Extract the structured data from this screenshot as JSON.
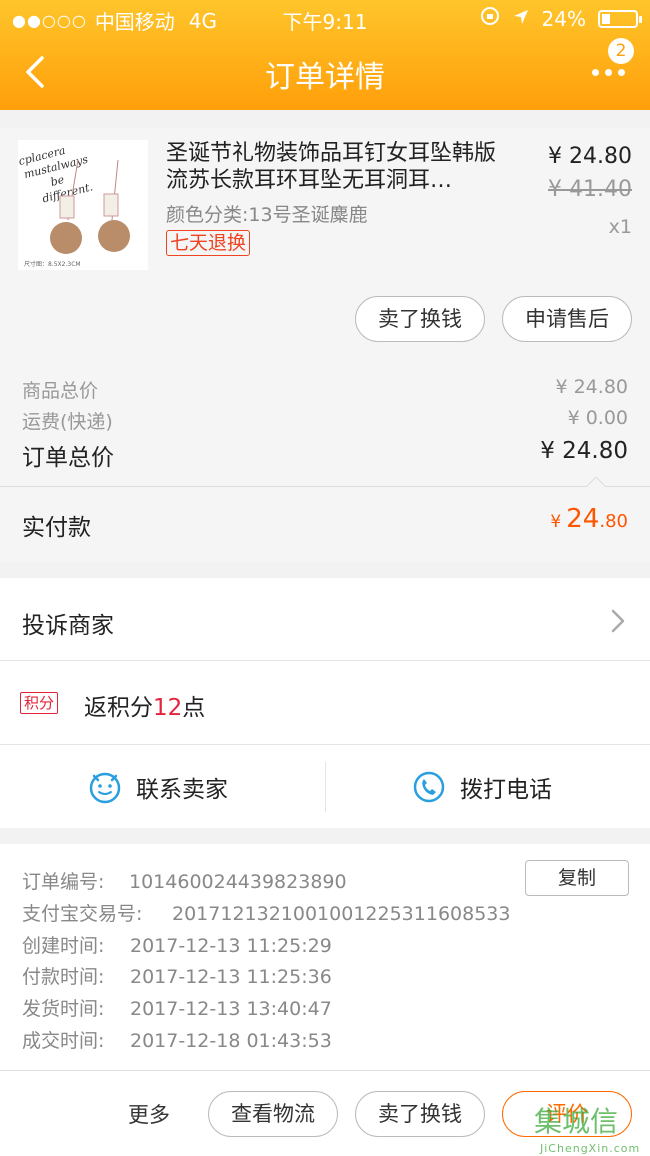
{
  "status_bar": {
    "signal": "●●○○○",
    "carrier": "中国移动",
    "network": "4G",
    "time": "下午9:11",
    "battery": "24%",
    "battery_level": 0.24
  },
  "nav": {
    "title": "订单详情",
    "badge": "2"
  },
  "product": {
    "title": "圣诞节礼物装饰品耳钉女耳坠韩版流苏长款耳环耳坠无耳洞耳…",
    "variant": "颜色分类:13号圣诞麋鹿",
    "tag": "七天退换",
    "price": "¥ 24.80",
    "original_price": "¥ 41.40",
    "quantity": "x1",
    "thumb_text_1": "cplacera",
    "thumb_text_2": "mustalways",
    "thumb_text_3": "be",
    "thumb_text_4": "different.",
    "thumb_caption": "尺寸图：8.5X2.3CM",
    "actions": {
      "sell": "卖了换钱",
      "after_sale": "申请售后"
    }
  },
  "totals": {
    "goods_label": "商品总价",
    "goods_value": "¥ 24.80",
    "shipping_label": "运费(快递)",
    "shipping_value": "¥ 0.00",
    "order_label": "订单总价",
    "order_value": "¥ 24.80",
    "paid_label": "实付款",
    "paid_currency": "¥",
    "paid_int": "24",
    "paid_dec": ".80"
  },
  "complain": {
    "label": "投诉商家"
  },
  "points": {
    "tag": "积分",
    "prefix": "返积分",
    "count": "12",
    "suffix": "点"
  },
  "contact": {
    "seller": "联系卖家",
    "phone": "拨打电话"
  },
  "order_info": {
    "order_no_label": "订单编号:",
    "order_no": "101460024439823890",
    "copy": "复制",
    "alipay_label": "支付宝交易号:",
    "alipay_no": "2017121321001001225311608533",
    "created_label": "创建时间:",
    "created": "2017-12-13 11:25:29",
    "paid_label": "付款时间:",
    "paid": "2017-12-13 11:25:36",
    "shipped_label": "发货时间:",
    "shipped": "2017-12-13 13:40:47",
    "completed_label": "成交时间:",
    "completed": "2017-12-18 01:43:53"
  },
  "footer": {
    "more": "更多",
    "logistics": "查看物流",
    "sell": "卖了换钱",
    "review": "评价"
  },
  "watermark": {
    "text": "集城信",
    "sub": "JiChengXin.com"
  },
  "colors": {
    "header_top": "#ffc52b",
    "header_bottom": "#ff9f0a",
    "accent": "#ff5500",
    "points": "#e4233a",
    "icon_blue": "#2a9fe0"
  }
}
